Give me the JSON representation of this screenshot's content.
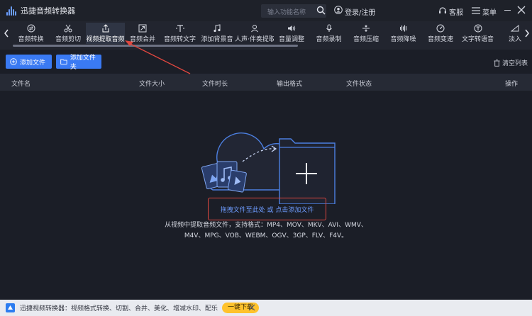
{
  "titlebar": {
    "app_title": "迅捷音频转换器",
    "search_placeholder": "输入功能名称",
    "login_label": "登录/注册",
    "service_label": "客服",
    "menu_label": "菜单"
  },
  "toolbar": {
    "items": [
      {
        "label": "音频转换",
        "icon": "convert-icon"
      },
      {
        "label": "音频剪切",
        "icon": "scissors-icon"
      },
      {
        "label": "视频提取音频",
        "icon": "extract-icon",
        "active": true
      },
      {
        "label": "音频合并",
        "icon": "merge-icon"
      },
      {
        "label": "音频转文字",
        "icon": "text-icon"
      },
      {
        "label": "添加背景音",
        "icon": "background-music-icon"
      },
      {
        "label": "人声·伴奏提取",
        "icon": "vocal-icon"
      },
      {
        "label": "音量调整",
        "icon": "volume-icon"
      },
      {
        "label": "音频录制",
        "icon": "microphone-icon"
      },
      {
        "label": "音频压缩",
        "icon": "compress-icon"
      },
      {
        "label": "音频降噪",
        "icon": "denoise-icon"
      },
      {
        "label": "音频变速",
        "icon": "speed-icon"
      },
      {
        "label": "文字转语音",
        "icon": "tts-icon"
      },
      {
        "label": "淡入",
        "icon": "fade-icon"
      }
    ]
  },
  "actions": {
    "add_file": "添加文件",
    "add_folder": "添加文件夹",
    "clear_list": "清空列表"
  },
  "table": {
    "columns": [
      "文件名",
      "文件大小",
      "文件时长",
      "输出格式",
      "文件状态",
      "操作"
    ]
  },
  "drop_area": {
    "hint": "拖拽文件至此处 或 点击添加文件",
    "formats_line1": "从视频中提取音频文件，支持格式：MP4、MOV、MKV、AVI、WMV、",
    "formats_line2": "M4V、MPG、VOB、WEBM、OGV、3GP、FLV、F4V。"
  },
  "footer": {
    "text": "迅捷视频转换器：视频格式转换、切割、合并、美化、增减水印、配乐",
    "download_label": "一键下载"
  },
  "colors": {
    "accent": "#3a7af3",
    "annotation": "#e0473f",
    "download": "#ffc22b"
  }
}
